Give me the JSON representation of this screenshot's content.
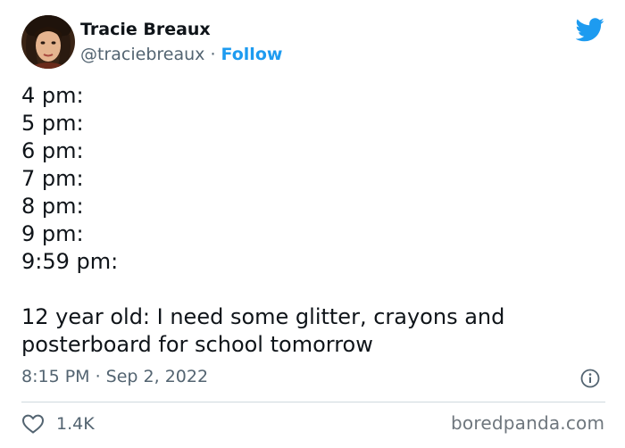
{
  "author": {
    "name": "Tracie Breaux",
    "handle": "@traciebreaux",
    "separator": " · ",
    "follow_label": "Follow"
  },
  "tweet": {
    "lines": [
      "4 pm:",
      "5 pm:",
      "6 pm:",
      "7 pm:",
      "8 pm:",
      "9 pm:",
      "9:59 pm:"
    ],
    "message_line1": "12 year old: I need some glitter, crayons and",
    "message_line2": "posterboard for school tomorrow",
    "timestamp": "8:15 PM · Sep 2, 2022"
  },
  "engagement": {
    "likes": "1.4K"
  },
  "watermark": "boredpanda.com",
  "icons": {
    "brand": "twitter-bird-icon",
    "info": "info-icon",
    "like": "heart-icon"
  },
  "colors": {
    "accent": "#1d9bf0",
    "text": "#0f1419",
    "muted": "#536471",
    "divider": "#cfd9de"
  }
}
